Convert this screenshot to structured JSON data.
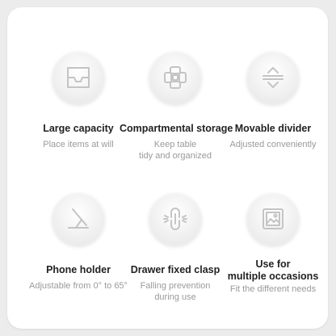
{
  "features": [
    {
      "icon": "tray-icon",
      "title": "Large capacity",
      "description": "Place items at will"
    },
    {
      "icon": "compartments-icon",
      "title": "Compartmental storage",
      "description_lines": [
        "Keep table",
        "tidy and organized"
      ]
    },
    {
      "icon": "divider-arrows-icon",
      "title": "Movable divider",
      "description": "Adjusted conveniently"
    },
    {
      "icon": "phone-stand-icon",
      "title": "Phone holder",
      "description": "Adjustable from 0° to 65°"
    },
    {
      "icon": "clasp-icon",
      "title": "Drawer fixed clasp",
      "description_lines": [
        "Falling prevention",
        "during use"
      ]
    },
    {
      "icon": "picture-icon",
      "title_lines": [
        "Use for",
        "multiple occasions"
      ],
      "description": "Fit the different needs"
    }
  ],
  "colors": {
    "background": "#ececec",
    "card": "#ffffff",
    "title": "#222222",
    "description": "#9a9a9a",
    "icon": "#c4c4c4"
  }
}
